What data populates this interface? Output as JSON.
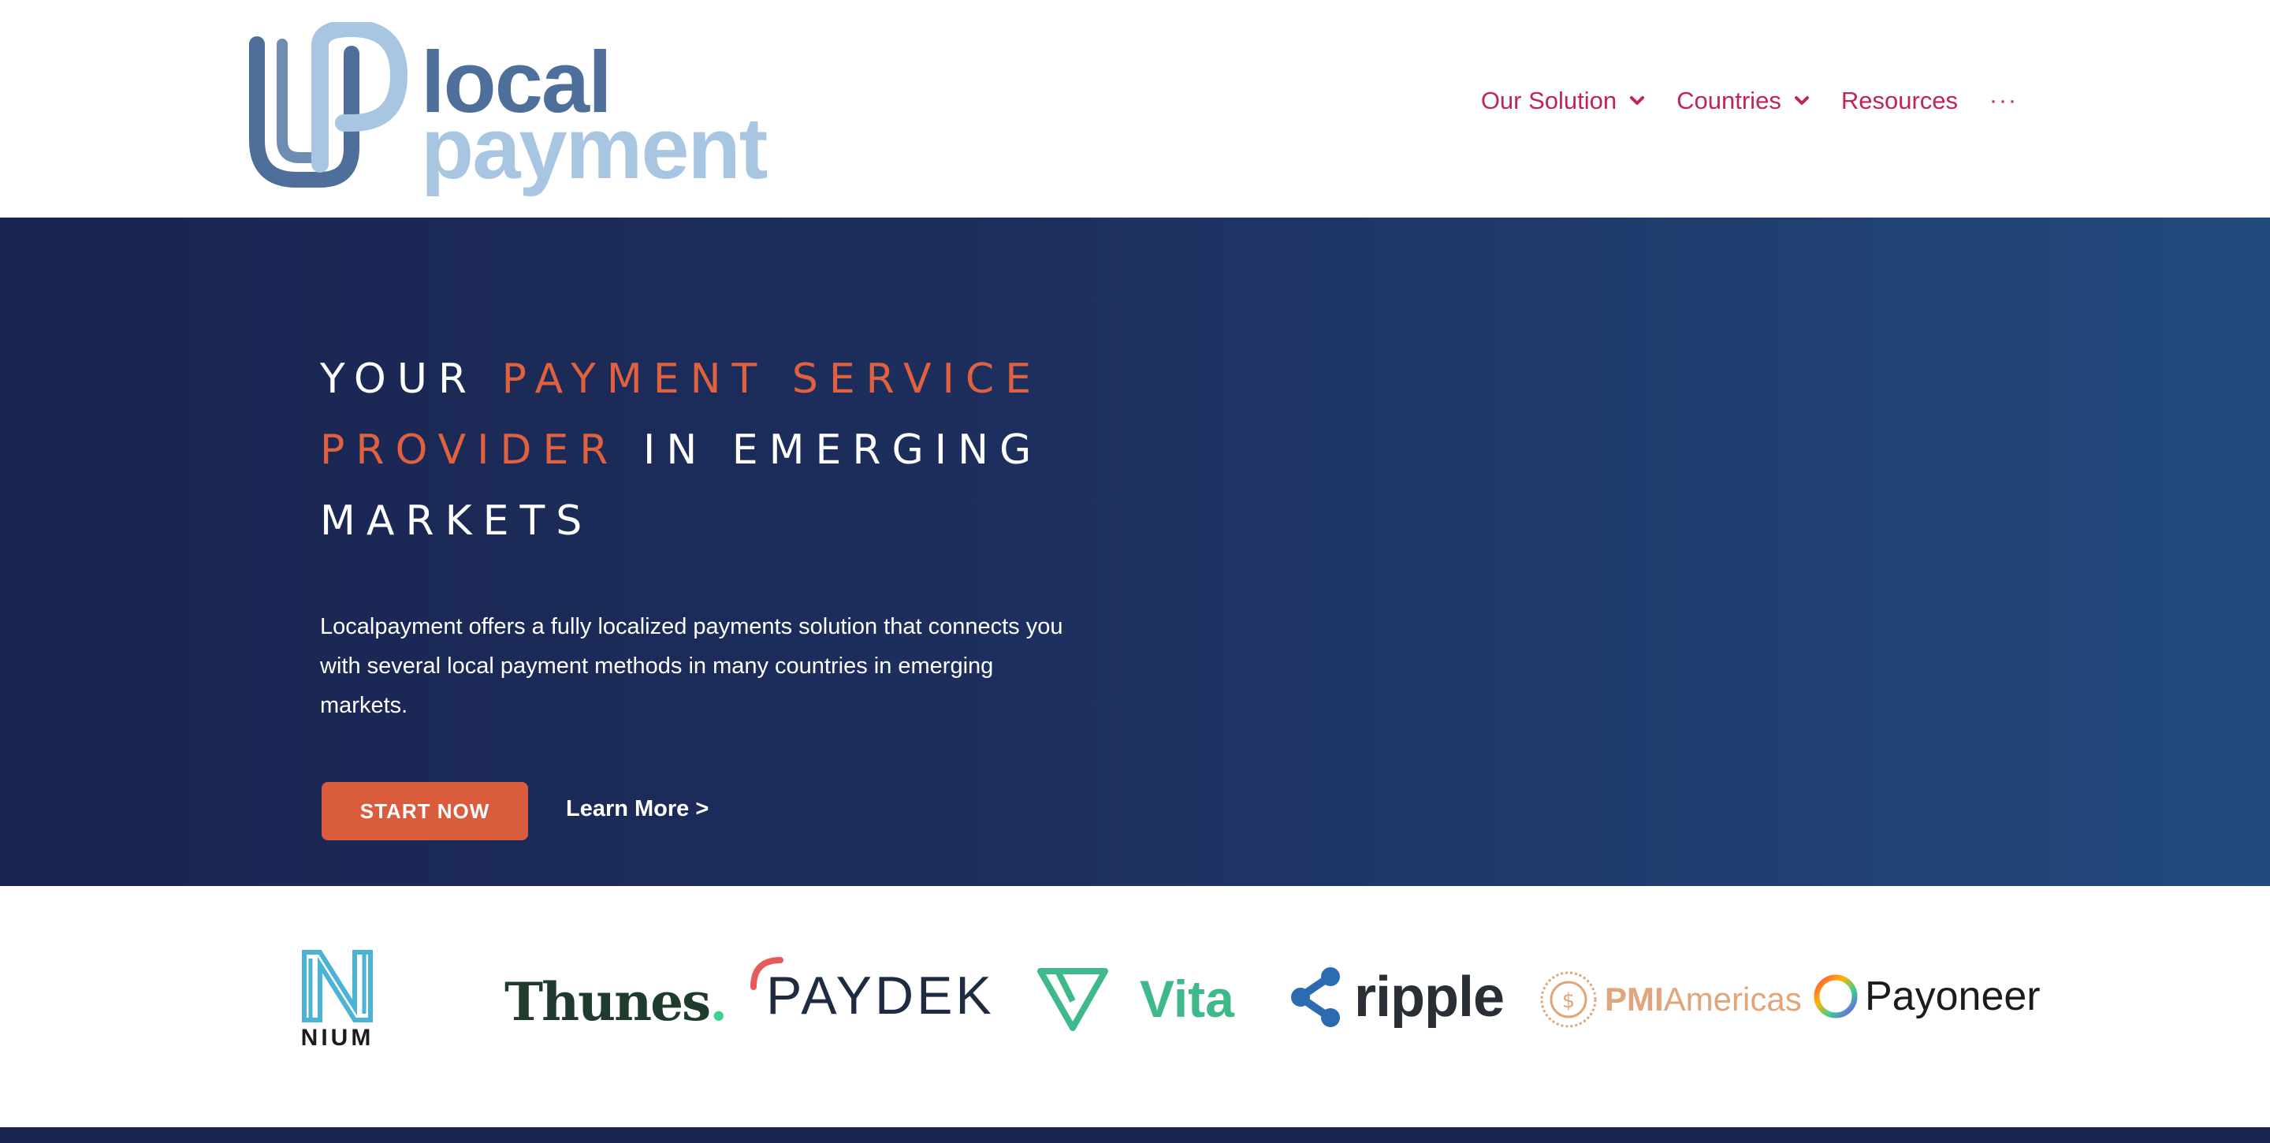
{
  "header": {
    "logo": {
      "line1": "local",
      "line2": "payment"
    },
    "nav": [
      {
        "label": "Our Solution",
        "has_dropdown": true
      },
      {
        "label": "Countries",
        "has_dropdown": true
      },
      {
        "label": "Resources",
        "has_dropdown": false
      }
    ],
    "more_label": "···"
  },
  "hero": {
    "title_part1": "YOUR ",
    "title_accent": "PAYMENT SERVICE PROVIDER",
    "title_part2": " IN EMERGING MARKETS",
    "description": "Localpayment offers a fully localized payments solution that connects you with several local  payment methods in many countries in emerging markets.",
    "cta_primary": "START NOW",
    "cta_secondary": "Learn More >"
  },
  "partners": {
    "items": [
      {
        "name": "NIUM",
        "color": "#1c1c1c",
        "accent": "#4ab3d6"
      },
      {
        "name": "Thunes",
        "suffix": ".",
        "color": "#1e3b2e",
        "accent": "#3fcf8e"
      },
      {
        "name": "PAYDEK",
        "color": "#1f2b40",
        "accent": "#e85a5a"
      },
      {
        "name": "Vita",
        "color": "#3fb98a"
      },
      {
        "name": "ripple",
        "color": "#2a2f36",
        "accent": "#2c6bb0"
      },
      {
        "name": "PMI",
        "name2": "Americas",
        "color": "#e0a57a"
      },
      {
        "name": "Payoneer",
        "color": "#1c1c1c"
      }
    ]
  },
  "colors": {
    "nav_text": "#c0245c",
    "hero_bg_start": "#1a2450",
    "hero_bg_end": "#234a7e",
    "accent_orange": "#e0613f",
    "button_bg": "#d95c3d"
  }
}
